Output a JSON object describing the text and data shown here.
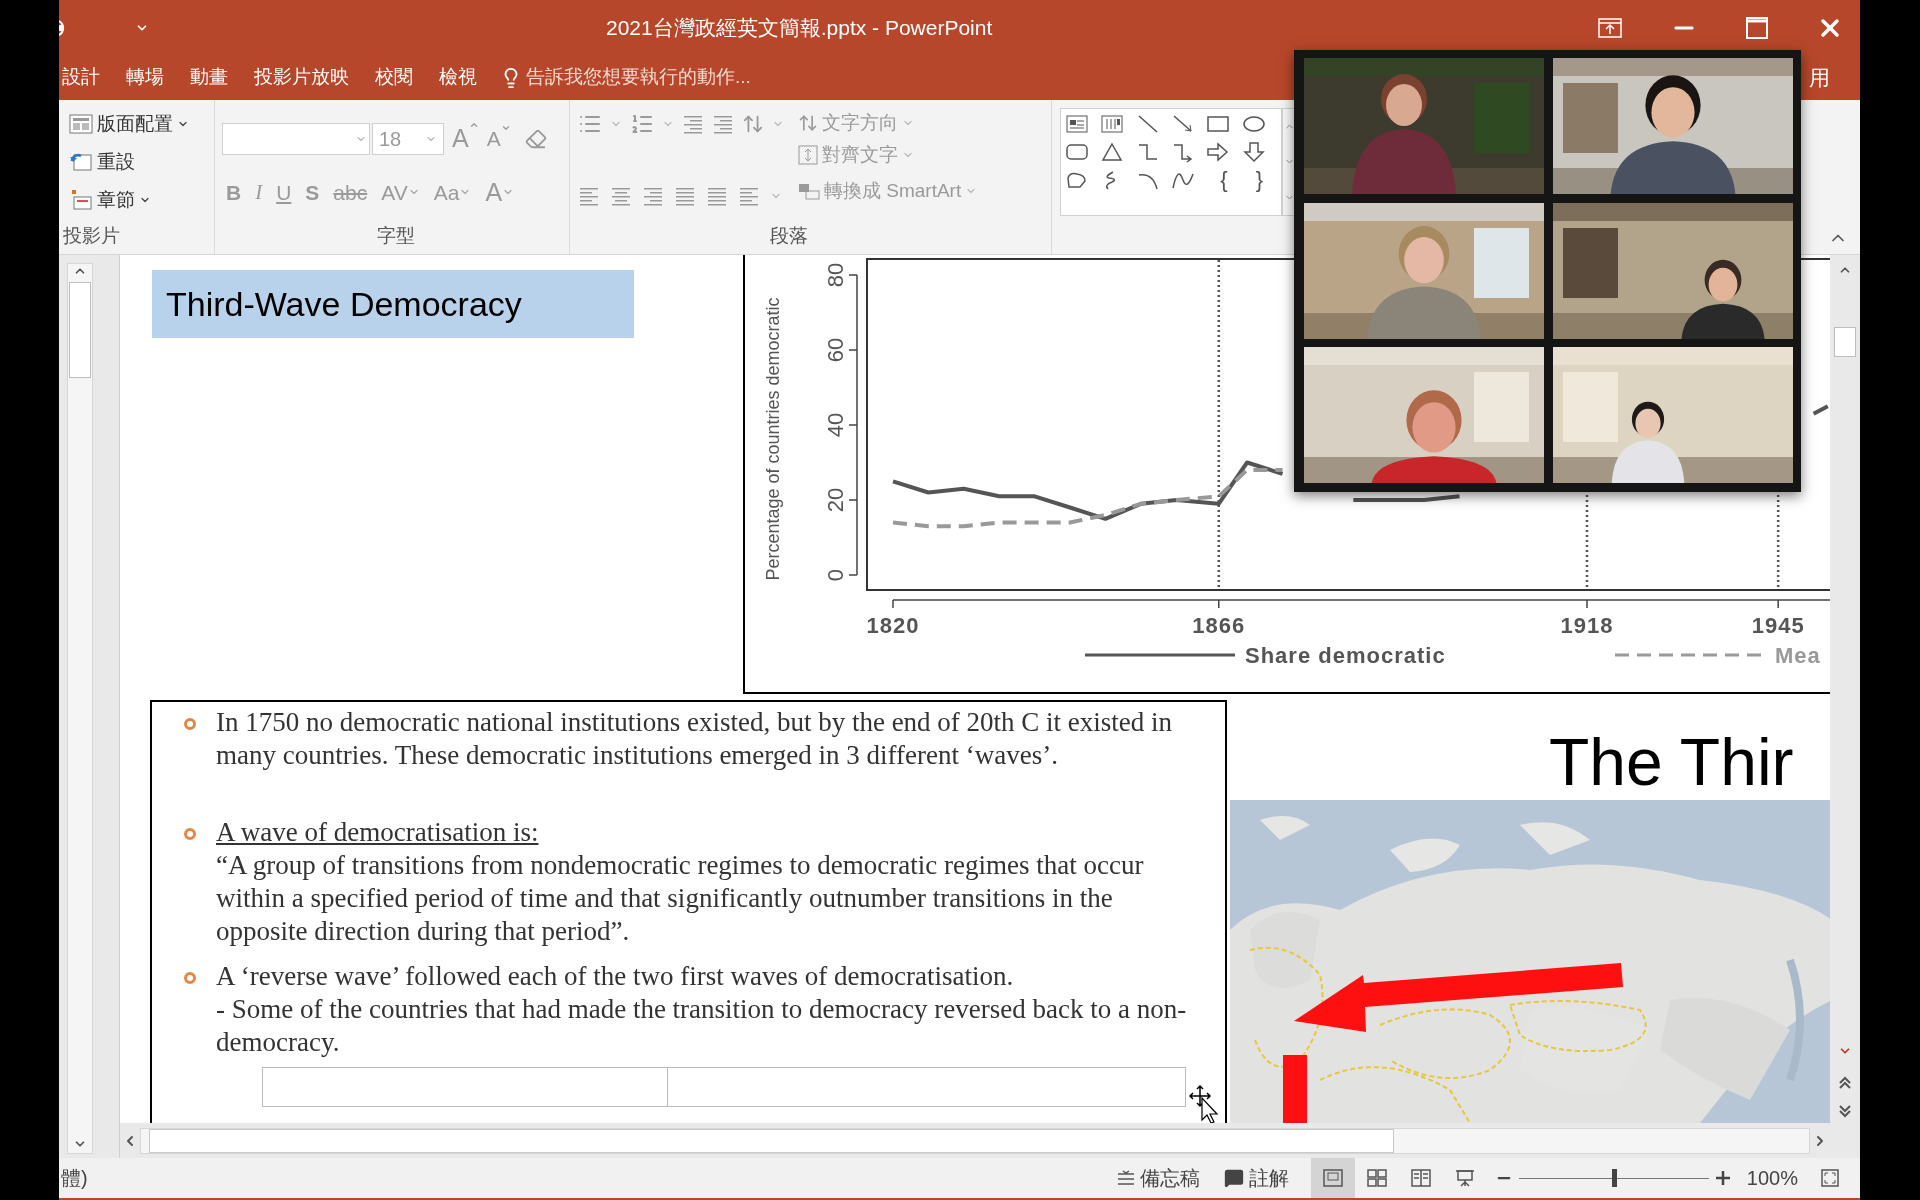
{
  "window": {
    "title": "2021台灣政經英文簡報.pptx - PowerPoint"
  },
  "tabs": [
    {
      "label": "設計",
      "selected": false
    },
    {
      "label": "轉場",
      "selected": false
    },
    {
      "label": "動畫",
      "selected": false
    },
    {
      "label": "投影片放映",
      "selected": false
    },
    {
      "label": "校閱",
      "selected": false
    },
    {
      "label": "檢視",
      "selected": false
    }
  ],
  "tell_me": {
    "placeholder": "告訴我您想要執行的動作..."
  },
  "share_label": "用",
  "ribbon": {
    "slides_group": {
      "label": "投影片",
      "buttons": [
        {
          "label": "版面配置",
          "dropdown": true
        },
        {
          "label": "重設",
          "dropdown": false
        },
        {
          "label": "章節",
          "dropdown": true
        }
      ]
    },
    "font_group": {
      "label": "字型",
      "disabled": true,
      "font_size": "18",
      "grow_shrink": [
        "A",
        "A"
      ],
      "format_buttons": [
        {
          "label": "B",
          "dropdown": false
        },
        {
          "label": "I",
          "dropdown": false
        },
        {
          "label": "U",
          "dropdown": false
        },
        {
          "label": "S",
          "dropdown": false
        },
        {
          "label": "abc",
          "dropdown": false
        },
        {
          "label": "AV",
          "dropdown": true
        },
        {
          "label": "Aa",
          "dropdown": true
        },
        {
          "label": "A",
          "dropdown": true
        }
      ]
    },
    "paragraph_group": {
      "label": "段落",
      "disabled": true,
      "text_direction": "文字方向",
      "align_text": "對齊文字",
      "smartart": "轉換成 SmartArt"
    },
    "drawing_group": {
      "braces": [
        "{",
        "}"
      ]
    }
  },
  "slide": {
    "title_box": "Third-Wave Democracy",
    "chart": {
      "chart_data": {
        "type": "line",
        "ylabel": "Percentage of countries democratic",
        "x": [
          1820,
          1825,
          1830,
          1835,
          1840,
          1845,
          1850,
          1855,
          1860,
          1866,
          1870,
          1875,
          1880,
          1885,
          1890,
          1895,
          1900,
          1950,
          1952
        ],
        "series": [
          {
            "name": "Share democratic",
            "line_style": "solid",
            "color": "#555555",
            "values": [
              25,
              22,
              23,
              21,
              21,
              18,
              15,
              19,
              20,
              19,
              30,
              27,
              null,
              20,
              20,
              20,
              21,
              43,
              45
            ]
          },
          {
            "name": "Mea",
            "line_style": "dashed",
            "color": "#999999",
            "values": [
              14,
              13,
              13,
              14,
              14,
              14,
              16,
              19,
              20,
              21,
              28,
              28,
              null,
              null,
              null,
              null,
              null,
              null,
              null
            ]
          }
        ],
        "xlim": [
          1820,
          1955
        ],
        "grid": true,
        "xticks": [
          1820,
          1866,
          1918,
          1945
        ],
        "yticks": [
          0,
          20,
          40,
          60,
          80
        ],
        "ylim": [
          0,
          80
        ]
      }
    },
    "text_box": {
      "bullets": [
        {
          "paragraphs": [
            "In 1750 no democratic national institutions existed, but by the end of 20th C it existed in many countries. These democratic institutions emerged in 3 different ‘waves’."
          ]
        },
        {
          "heading": "A wave of democratisation is:",
          "paragraphs": [
            "“A group of transitions from nondemocratic regimes to democratic regimes that occur within a specified period of time and that significantly outnumber transitions in the opposite direction during that period”."
          ]
        },
        {
          "paragraphs": [
            "A ‘reverse wave’ followed each of the two first waves of democratisation.",
            "- Some of the countries that had made the transition to democracy reversed back to a non-democracy."
          ]
        }
      ]
    },
    "map_panel": {
      "title": "The Thir"
    }
  },
  "status_bar": {
    "language": "體)",
    "notes": "備忘稿",
    "comments": "註解",
    "views": [
      {
        "selected": true
      },
      {
        "selected": false
      },
      {
        "selected": false
      },
      {
        "selected": false
      }
    ],
    "zoom": {
      "level": 0.5,
      "reading": "100%"
    }
  }
}
